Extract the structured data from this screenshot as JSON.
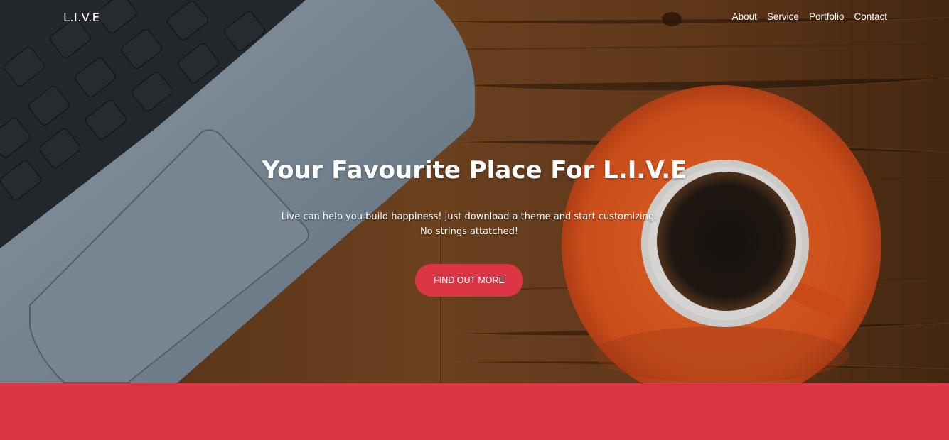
{
  "brand": {
    "name": "L.I.V.E"
  },
  "nav": {
    "items": [
      {
        "label": "About"
      },
      {
        "label": "Service"
      },
      {
        "label": "Portfolio"
      },
      {
        "label": "Contact"
      }
    ]
  },
  "hero": {
    "headline": "Your Favourite Place For L.I.V.E",
    "sub_line_1": "Live can help you build happiness! just download a theme and start customizing.",
    "sub_line_2": "No strings attatched!",
    "cta_label": "FIND OUT MORE",
    "background_image": "laptop-and-coffee-on-wood-desk"
  },
  "colors": {
    "accent": "#dc3545",
    "text": "#ffffff"
  }
}
